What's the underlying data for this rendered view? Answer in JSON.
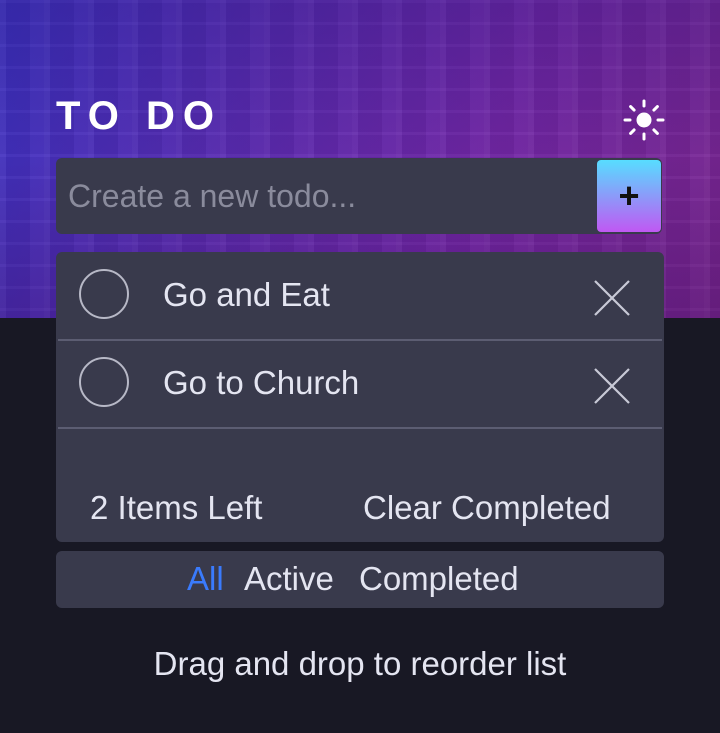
{
  "header": {
    "title": "TO DO",
    "theme_icon": "sun-icon"
  },
  "new_todo": {
    "placeholder": "Create a new todo...",
    "value": "",
    "add_label": "+"
  },
  "todos": [
    {
      "text": "Go and Eat",
      "completed": false
    },
    {
      "text": "Go to Church",
      "completed": false
    }
  ],
  "footer": {
    "items_left": "2 Items Left",
    "clear_completed": "Clear Completed"
  },
  "filters": {
    "all": "All",
    "active": "Active",
    "completed": "Completed",
    "selected": "all"
  },
  "hint": "Drag and drop to reorder list",
  "colors": {
    "accent": "#3a7bfd",
    "card": "#393a4c",
    "background": "#181824",
    "gradient_start": "#57ddff",
    "gradient_end": "#c058f3"
  }
}
